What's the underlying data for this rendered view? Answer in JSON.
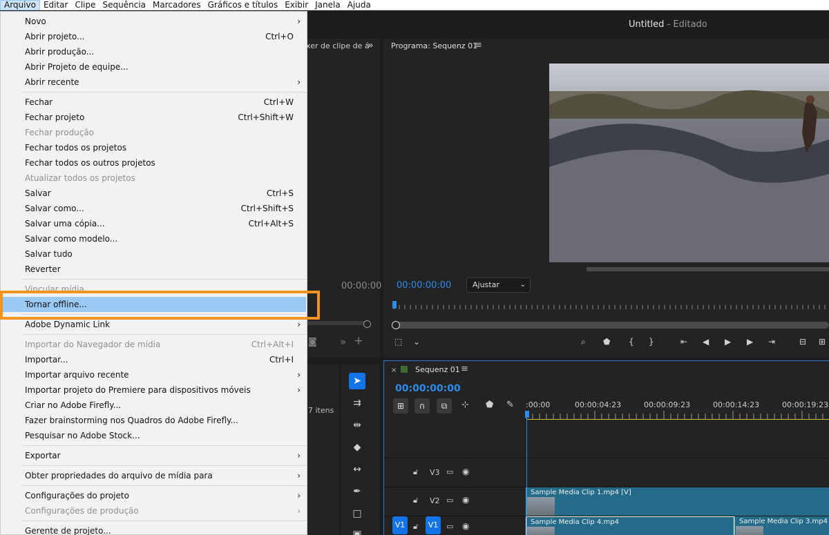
{
  "menubar": {
    "items": [
      "Arquivo",
      "Editar",
      "Clipe",
      "Sequência",
      "Marcadores",
      "Gráficos e títulos",
      "Exibir",
      "Janela",
      "Ajuda"
    ]
  },
  "title": {
    "name": "Untitled",
    "status": " - Editado"
  },
  "file_menu": {
    "items": [
      {
        "label": "Novo",
        "shortcut": "",
        "arrow": "›",
        "disabled": false
      },
      {
        "label": "Abrir projeto...",
        "shortcut": "Ctrl+O",
        "arrow": "",
        "disabled": false
      },
      {
        "label": "Abrir produção...",
        "shortcut": "",
        "arrow": "",
        "disabled": false
      },
      {
        "label": "Abrir Projeto de equipe...",
        "shortcut": "",
        "arrow": "",
        "disabled": false
      },
      {
        "label": "Abrir recente",
        "shortcut": "",
        "arrow": "›",
        "disabled": false
      },
      {
        "label": "Fechar",
        "shortcut": "Ctrl+W",
        "arrow": "",
        "disabled": false
      },
      {
        "label": "Fechar projeto",
        "shortcut": "Ctrl+Shift+W",
        "arrow": "",
        "disabled": false
      },
      {
        "label": "Fechar produção",
        "shortcut": "",
        "arrow": "",
        "disabled": true
      },
      {
        "label": "Fechar todos os projetos",
        "shortcut": "",
        "arrow": "",
        "disabled": false
      },
      {
        "label": "Fechar todos os outros projetos",
        "shortcut": "",
        "arrow": "",
        "disabled": false
      },
      {
        "label": "Atualizar todos os projetos",
        "shortcut": "",
        "arrow": "",
        "disabled": true
      },
      {
        "label": "Salvar",
        "shortcut": "Ctrl+S",
        "arrow": "",
        "disabled": false
      },
      {
        "label": "Salvar como...",
        "shortcut": "Ctrl+Shift+S",
        "arrow": "",
        "disabled": false
      },
      {
        "label": "Salvar uma cópia...",
        "shortcut": "Ctrl+Alt+S",
        "arrow": "",
        "disabled": false
      },
      {
        "label": "Salvar como modelo...",
        "shortcut": "",
        "arrow": "",
        "disabled": false
      },
      {
        "label": "Salvar tudo",
        "shortcut": "",
        "arrow": "",
        "disabled": false
      },
      {
        "label": "Reverter",
        "shortcut": "",
        "arrow": "",
        "disabled": false
      },
      {
        "label": "Vincular mídia...",
        "shortcut": "",
        "arrow": "",
        "disabled": true
      },
      {
        "label": "Tornar offline...",
        "shortcut": "",
        "arrow": "",
        "disabled": false
      },
      {
        "label": "Adobe Dynamic Link",
        "shortcut": "",
        "arrow": "›",
        "disabled": false
      },
      {
        "label": "Importar do Navegador de mídia",
        "shortcut": "Ctrl+Alt+I",
        "arrow": "",
        "disabled": true
      },
      {
        "label": "Importar...",
        "shortcut": "Ctrl+I",
        "arrow": "",
        "disabled": false
      },
      {
        "label": "Importar arquivo recente",
        "shortcut": "",
        "arrow": "›",
        "disabled": false
      },
      {
        "label": "Importar projeto do Premiere para dispositivos móveis",
        "shortcut": "",
        "arrow": "›",
        "disabled": false
      },
      {
        "label": "Criar no Adobe Firefly...",
        "shortcut": "",
        "arrow": "",
        "disabled": false
      },
      {
        "label": "Fazer brainstorming nos Quadros do Adobe Firefly...",
        "shortcut": "",
        "arrow": "",
        "disabled": false
      },
      {
        "label": "Pesquisar no Adobe Stock...",
        "shortcut": "",
        "arrow": "",
        "disabled": false
      },
      {
        "label": "Exportar",
        "shortcut": "",
        "arrow": "›",
        "disabled": false
      },
      {
        "label": "Obter propriedades do arquivo de mídia para",
        "shortcut": "",
        "arrow": "›",
        "disabled": false
      },
      {
        "label": "Configurações do projeto",
        "shortcut": "",
        "arrow": "›",
        "disabled": false
      },
      {
        "label": "Configurações de produção",
        "shortcut": "",
        "arrow": "›",
        "disabled": true
      },
      {
        "label": "Gerente de projeto...",
        "shortcut": "",
        "arrow": "",
        "disabled": false
      }
    ]
  },
  "source": {
    "tab_label": "ixer de clipe de á",
    "timecode": "00:00:00"
  },
  "program": {
    "title": "Programa: Sequenz 01",
    "timecode": "00:00:00:00",
    "fit_value": "Ajustar"
  },
  "project": {
    "items_label": "7 itens"
  },
  "timeline": {
    "sequence_name": "Sequenz 01",
    "timecode": "00:00:00:00",
    "ruler_labels": [
      ":00:00",
      "00:00:04:23",
      "00:00:09:23",
      "00:00:14:23",
      "00:00:19:23"
    ],
    "tracks": [
      "V3",
      "V2",
      "V1"
    ],
    "clips": [
      {
        "name": "Sample Media Clip 1.mp4 [V]"
      },
      {
        "name": "Sample Media Clip 4.mp4"
      },
      {
        "name": "Sample Media Clip 3.mp4"
      }
    ],
    "source_patch": "V1"
  },
  "colors": {
    "accent": "#2d8ceb",
    "highlight_box": "#f7941d",
    "menu_highlight": "#99c9f4"
  }
}
